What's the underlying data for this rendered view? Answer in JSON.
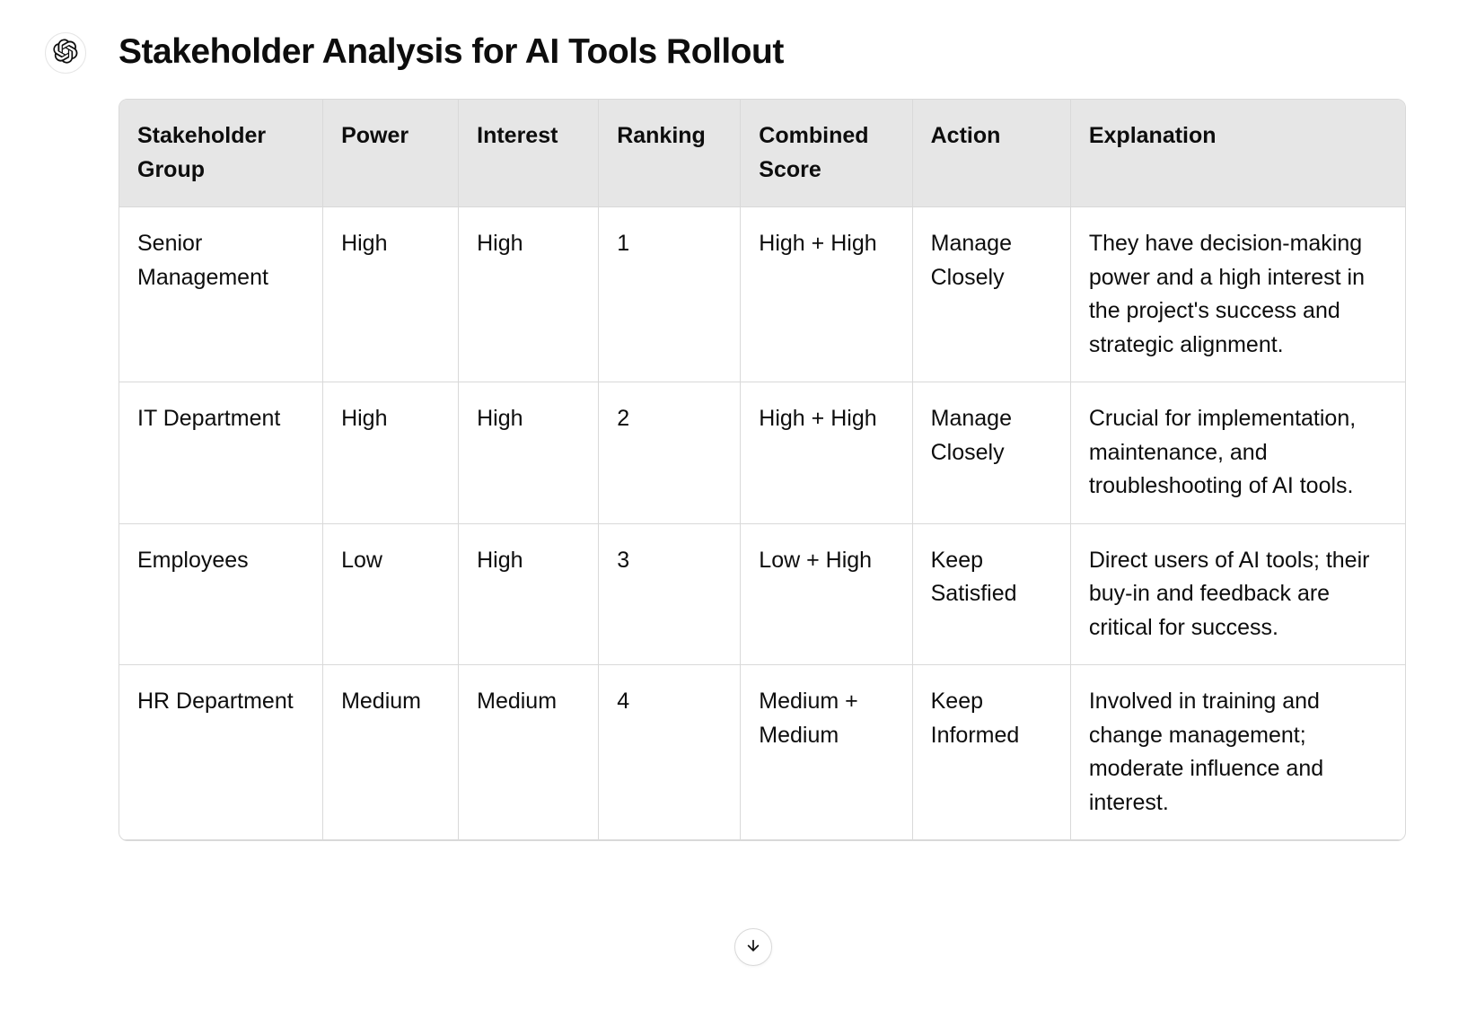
{
  "title": "Stakeholder Analysis for AI Tools Rollout",
  "headers": {
    "group": "Stakeholder Group",
    "power": "Power",
    "interest": "Interest",
    "ranking": "Ranking",
    "score": "Combined Score",
    "action": "Action",
    "explanation": "Explanation"
  },
  "rows": [
    {
      "group": "Senior Management",
      "power": "High",
      "interest": "High",
      "ranking": "1",
      "score": "High + High",
      "action": "Manage Closely",
      "explanation": "They have decision-making power and a high interest in the project's success and strategic alignment."
    },
    {
      "group": "IT Department",
      "power": "High",
      "interest": "High",
      "ranking": "2",
      "score": "High + High",
      "action": "Manage Closely",
      "explanation": "Crucial for implementation, maintenance, and troubleshooting of AI tools."
    },
    {
      "group": "Employees",
      "power": "Low",
      "interest": "High",
      "ranking": "3",
      "score": "Low + High",
      "action": "Keep Satisfied",
      "explanation": "Direct users of AI tools; their buy-in and feedback are critical for success."
    },
    {
      "group": "HR Department",
      "power": "Medium",
      "interest": "Medium",
      "ranking": "4",
      "score": "Medium + Medium",
      "action": "Keep Informed",
      "explanation": "Involved in training and change management; moderate influence and interest."
    }
  ]
}
